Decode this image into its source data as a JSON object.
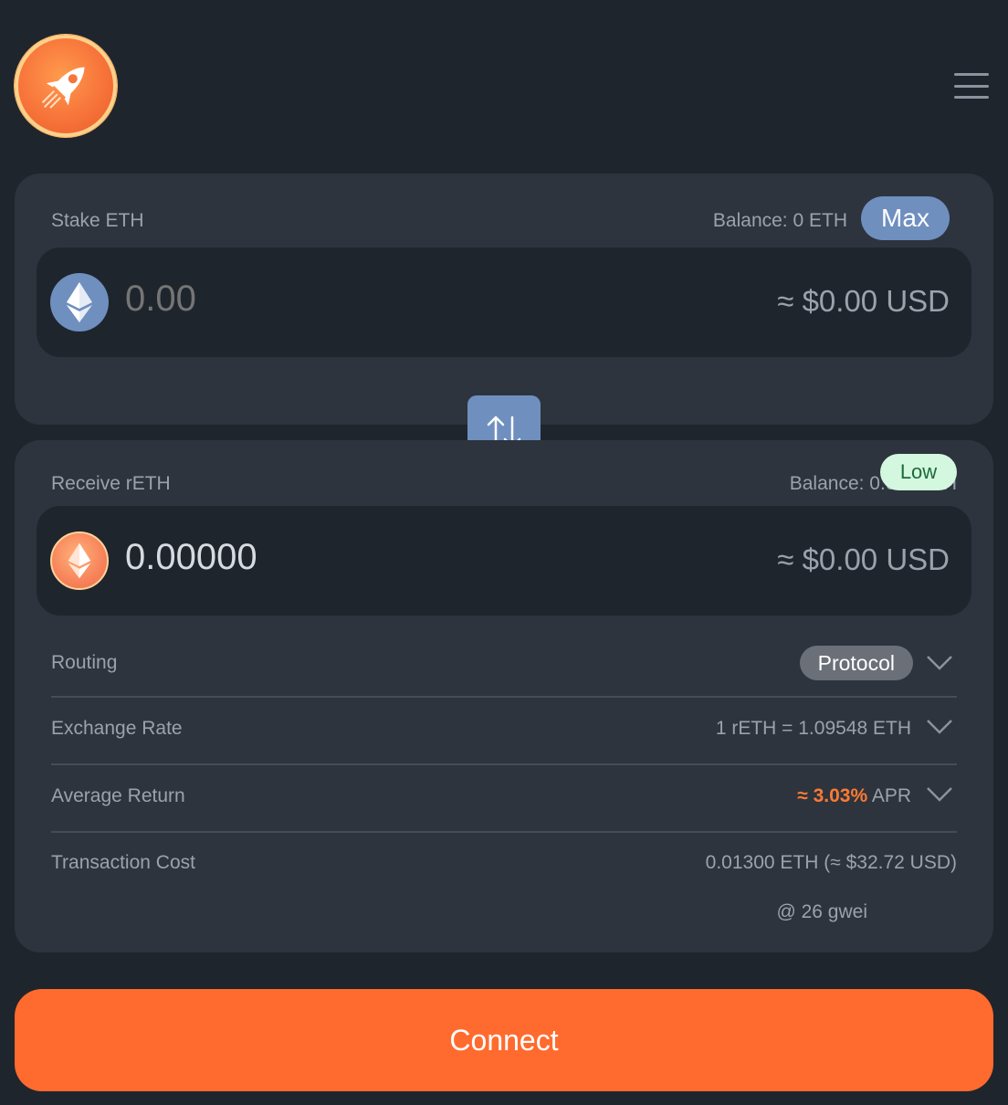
{
  "header": {
    "logo_icon": "rocket-icon",
    "menu_icon": "hamburger-menu-icon"
  },
  "stake": {
    "label": "Stake ETH",
    "balance": "Balance: 0 ETH",
    "max_label": "Max",
    "amount_placeholder": "0.00",
    "usd_value": "≈  $0.00 USD",
    "token_icon": "ethereum-icon"
  },
  "swap": {
    "icon": "swap-arrows-icon"
  },
  "receive": {
    "label": "Receive rETH",
    "balance": "Balance: 0.00 rETH",
    "amount": "0.00000",
    "usd_value": "≈  $0.00 USD",
    "token_icon": "reth-icon"
  },
  "details": {
    "routing_label": "Routing",
    "routing_value": "Protocol",
    "exchange_label": "Exchange Rate",
    "exchange_value": "1 rETH = 1.09548 ETH",
    "return_label": "Average Return",
    "return_value": "≈ 3.03%",
    "return_unit": "APR",
    "cost_label": "Transaction Cost",
    "cost_value": "0.01300 ETH (≈ $32.72 USD)",
    "gas_value": "@ 26 gwei",
    "gas_level": "Low"
  },
  "connect_label": "Connect",
  "colors": {
    "background": "#1f252d",
    "card": "#2d343e",
    "accent": "#ff6b2e",
    "eth_blue": "#6f8fbf",
    "apr_orange": "#ff7a33",
    "low_green_bg": "#d4f7df"
  }
}
